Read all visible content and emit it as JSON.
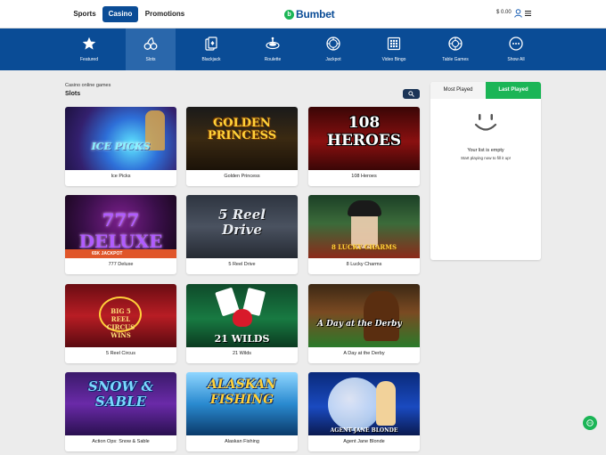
{
  "header": {
    "tabs": [
      {
        "label": "Sports",
        "active": false
      },
      {
        "label": "Casino",
        "active": true
      },
      {
        "label": "Promotions",
        "active": false
      }
    ],
    "logo": "Bumbet",
    "balance": "$ 0.00",
    "icons": [
      "user-icon",
      "menu-icon"
    ]
  },
  "categories": [
    {
      "label": "Featured",
      "icon": "star-icon"
    },
    {
      "label": "Slots",
      "icon": "cherries-icon",
      "active": true
    },
    {
      "label": "Blackjack",
      "icon": "cards-icon"
    },
    {
      "label": "Roulette",
      "icon": "roulette-icon"
    },
    {
      "label": "Jackpot",
      "icon": "jackpot-icon"
    },
    {
      "label": "Video Bingo",
      "icon": "bingo-icon"
    },
    {
      "label": "Table Games",
      "icon": "table-games-icon"
    },
    {
      "label": "Show All",
      "icon": "show-all-icon"
    }
  ],
  "main": {
    "breadcrumb": "Casino online games",
    "title": "Slots",
    "search_icon": "search-icon"
  },
  "games": [
    {
      "name": "Ice Picks",
      "art": "ICE PICKS"
    },
    {
      "name": "Golden Princess",
      "art": "GOLDEN PRINCESS"
    },
    {
      "name": "108 Heroes",
      "art": "108 HEROES"
    },
    {
      "name": "777 Deluxe",
      "art": "777 DELUXE",
      "badge": "65K JACKPOT"
    },
    {
      "name": "5 Reel Drive",
      "art": "5 Reel Drive"
    },
    {
      "name": "8 Lucky Charms",
      "art": "8 LUCKY CHARMS"
    },
    {
      "name": "5 Reel Circus",
      "art": "BIG 5 REEL CIRCUS WINS"
    },
    {
      "name": "21 Wilds",
      "art": "21 WILDS"
    },
    {
      "name": "A Day at the Derby",
      "art": "A Day at the Derby"
    },
    {
      "name": "Action Ops: Snow & Sable",
      "art": "SNOW & SABLE"
    },
    {
      "name": "Alaskan Fishing",
      "art": "ALASKAN FISHING"
    },
    {
      "name": "Agent Jane Blonde",
      "art": "AGENT JANE BLONDE"
    }
  ],
  "panel": {
    "tabs": [
      "Most Played",
      "Last Played"
    ],
    "active_tab": "Last Played",
    "empty_title": "Your list is empty",
    "empty_subtitle": "Start playing now to fill it up!"
  },
  "colors": {
    "brand_blue": "#0a4c96",
    "accent_green": "#1bb556",
    "jackpot_orange": "#e0562a"
  }
}
